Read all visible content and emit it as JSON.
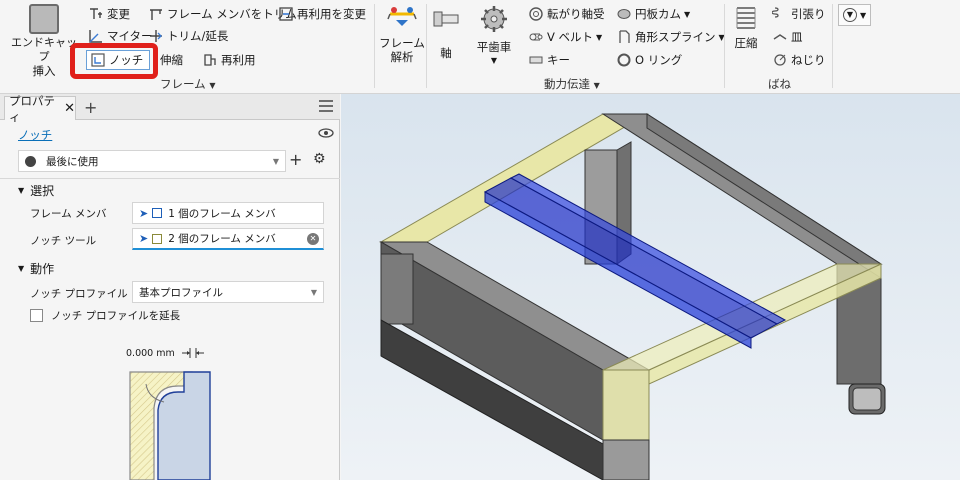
{
  "ribbon": {
    "insert_group": {
      "label_line1": "エンドキャップ",
      "label_line2": "挿入"
    },
    "frame_tools": {
      "change": "変更",
      "miter": "マイター",
      "notch": "ノッチ",
      "trim_to_frame": "フレーム メンバをトリム",
      "trim_extend": "トリム/延長",
      "lengthen": "伸縮",
      "change_reuse": "再利用を変更",
      "reuse": "再利用",
      "panel_label": "フレーム"
    },
    "frame_analysis": {
      "line1": "フレーム",
      "line2": "解析"
    },
    "power_transmission": {
      "shaft": "軸",
      "spur_gear": "平歯車",
      "bearing": "転がり軸受",
      "vbelt": "V ベルト",
      "key": "キー",
      "disc_cam": "円板カム",
      "spline": "角形スプライン",
      "oring": "O リング",
      "panel_label": "動力伝達"
    },
    "spring": {
      "compression": "圧縮",
      "extension": "引張り",
      "belleville": "皿",
      "torsion": "ねじり",
      "panel_label": "ばね"
    }
  },
  "property_panel": {
    "tab_title": "プロパティ",
    "feature_name": "ノッチ",
    "preset": "最後に使用",
    "section_select": "選択",
    "frame_member_label": "フレーム メンバ",
    "frame_member_value": "1 個のフレーム メンバ",
    "notch_tool_label": "ノッチ ツール",
    "notch_tool_value": "2 個のフレーム メンバ",
    "section_behavior": "動作",
    "notch_profile_label": "ノッチ プロファイル",
    "notch_profile_value": "基本プロファイル",
    "extend_profile_label": "ノッチ プロファイルを延長",
    "extend_profile_checked": false,
    "offset_value": "0.000 mm"
  },
  "colors": {
    "highlight_red": "#e0201b",
    "link_blue": "#0a6fb8",
    "selected_blue": "#1f2fc8",
    "frame_yellow": "#e8e7a8",
    "frame_gray": "#5b5b5b"
  }
}
